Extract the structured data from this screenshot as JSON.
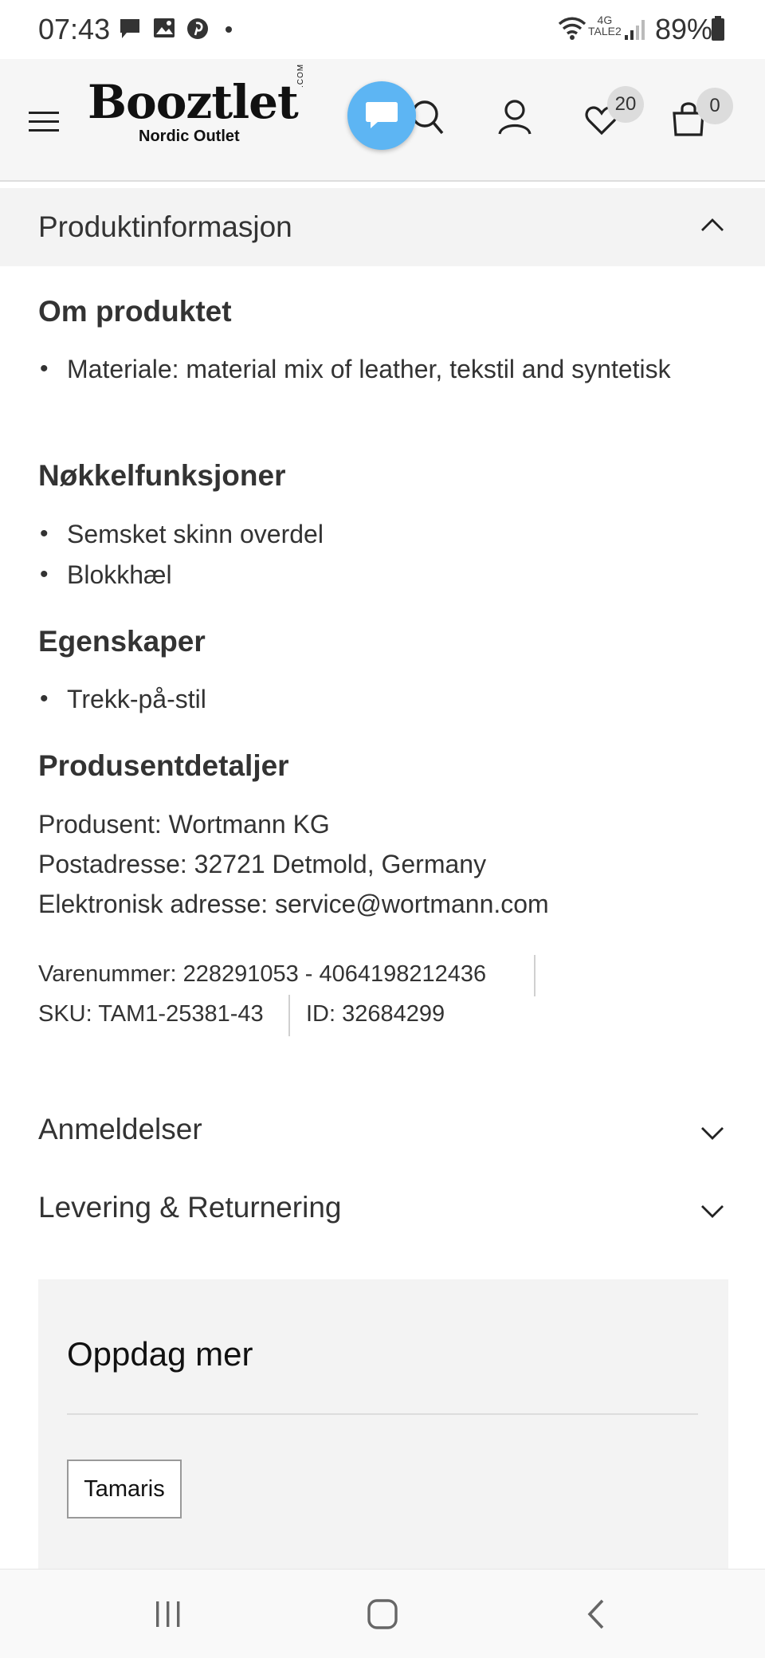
{
  "status_bar": {
    "time": "07:43",
    "network_label_top": "4G",
    "network_label_bottom": "TALE2",
    "battery": "89%",
    "icons": [
      "chat-notification-icon",
      "image-notification-icon",
      "pinterest-icon",
      "dot-icon",
      "wifi-icon",
      "signal-icon",
      "battery-icon"
    ]
  },
  "header": {
    "logo": "Booztlet",
    "logo_com": ".COM",
    "tagline": "Nordic Outlet",
    "wishlist_count": "20",
    "cart_count": "0",
    "icons": [
      "menu-icon",
      "chat-icon",
      "search-icon",
      "user-icon",
      "heart-icon",
      "bag-icon"
    ],
    "accent_color": "#5db5f3"
  },
  "product_info": {
    "title": "Produktinformasjon",
    "about_heading": "Om produktet",
    "about_items": [
      "Materiale: material mix of leather, tekstil and syntetisk"
    ],
    "features_heading": "Nøkkelfunksjoner",
    "features_items": [
      "Semsket skinn overdel",
      "Blokkhæl"
    ],
    "properties_heading": "Egenskaper",
    "properties_items": [
      "Trekk-på-stil"
    ],
    "manufacturer_heading": "Produsentdetaljer",
    "manufacturer_lines": [
      "Produsent: Wortmann KG",
      "Postadresse: 32721 Detmold, Germany",
      "Elektronisk adresse: service@wortmann.com"
    ],
    "item_number": "Varenummer: 228291053 - 4064198212436",
    "sku": "SKU: TAM1-25381-43",
    "id": "ID: 32684299"
  },
  "sections": {
    "reviews": "Anmeldelser",
    "delivery": "Levering & Returnering"
  },
  "discover": {
    "title": "Oppdag mer",
    "chips": [
      "Tamaris"
    ]
  },
  "nav_bar": {
    "icons": [
      "recent-apps-icon",
      "home-icon",
      "back-icon"
    ]
  }
}
